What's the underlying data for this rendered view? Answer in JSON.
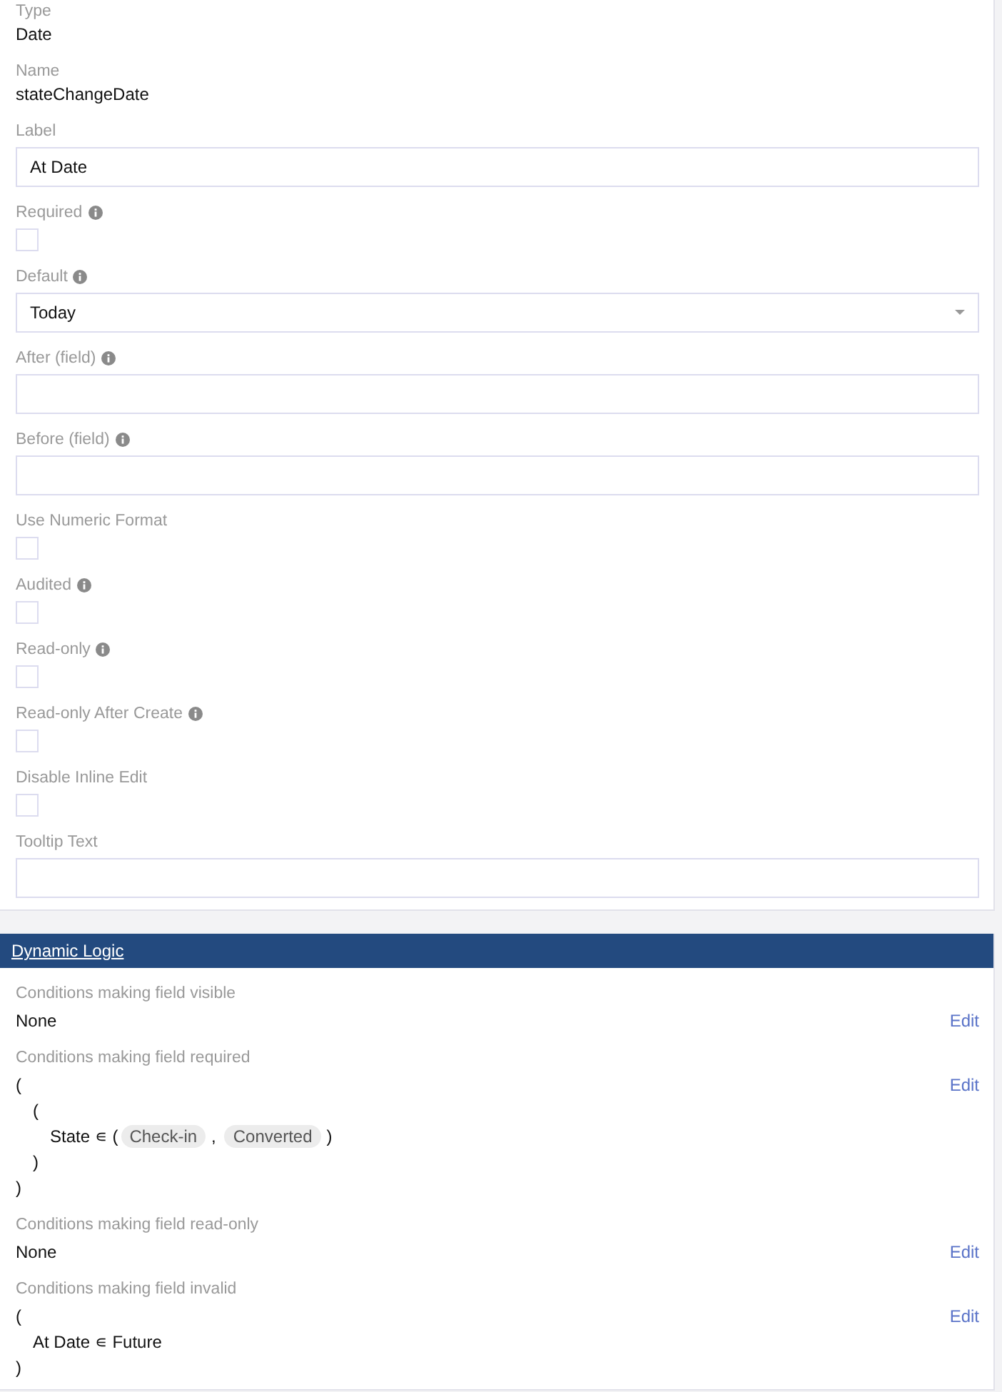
{
  "fields": [
    {
      "kind": "static",
      "label": "Type",
      "value": "Date"
    },
    {
      "kind": "static",
      "label": "Name",
      "value": "stateChangeDate"
    },
    {
      "kind": "text",
      "label": "Label",
      "value": "At Date"
    },
    {
      "kind": "checkbox",
      "label": "Required",
      "info": true,
      "checked": false
    },
    {
      "kind": "select",
      "label": "Default",
      "info": true,
      "value": "Today"
    },
    {
      "kind": "text",
      "label": "After (field)",
      "info": true
    },
    {
      "kind": "text",
      "label": "Before (field)",
      "info": true
    },
    {
      "kind": "checkbox",
      "label": "Use Numeric Format",
      "checked": false
    },
    {
      "kind": "checkbox",
      "label": "Audited",
      "info": true,
      "checked": false
    },
    {
      "kind": "checkbox",
      "label": "Read-only",
      "info": true,
      "checked": false
    },
    {
      "kind": "checkbox",
      "label": "Read-only After Create",
      "info": true,
      "checked": false
    },
    {
      "kind": "checkbox",
      "label": "Disable Inline Edit",
      "checked": false
    },
    {
      "kind": "text",
      "label": "Tooltip Text"
    }
  ],
  "dynamic_logic": {
    "title": "Dynamic Logic",
    "conditions": [
      {
        "label": "Conditions making field visible",
        "edit": "Edit",
        "lines": [
          {
            "kind": "text",
            "text": "None"
          }
        ]
      },
      {
        "label": "Conditions making field required",
        "edit": "Edit",
        "lines": [
          {
            "kind": "text",
            "text": "(",
            "children": [
              {
                "kind": "text",
                "text": "(",
                "children": [
                  {
                    "kind": "set",
                    "text": "State ∊ (",
                    "values": [
                      "Check-in",
                      "Converted"
                    ],
                    "separator": ",",
                    "end": ")"
                  }
                ]
              },
              {
                "kind": "text",
                "text": ")"
              }
            ]
          },
          {
            "kind": "text",
            "text": ")"
          }
        ]
      },
      {
        "label": "Conditions making field read-only",
        "edit": "Edit",
        "lines": [
          {
            "kind": "text",
            "text": "None"
          }
        ]
      },
      {
        "label": "Conditions making field invalid",
        "edit": "Edit",
        "lines": [
          {
            "kind": "text",
            "text": "(",
            "children": [
              {
                "kind": "text",
                "text": "At Date ∊ Future"
              }
            ]
          },
          {
            "kind": "text",
            "text": ")"
          }
        ]
      }
    ]
  }
}
